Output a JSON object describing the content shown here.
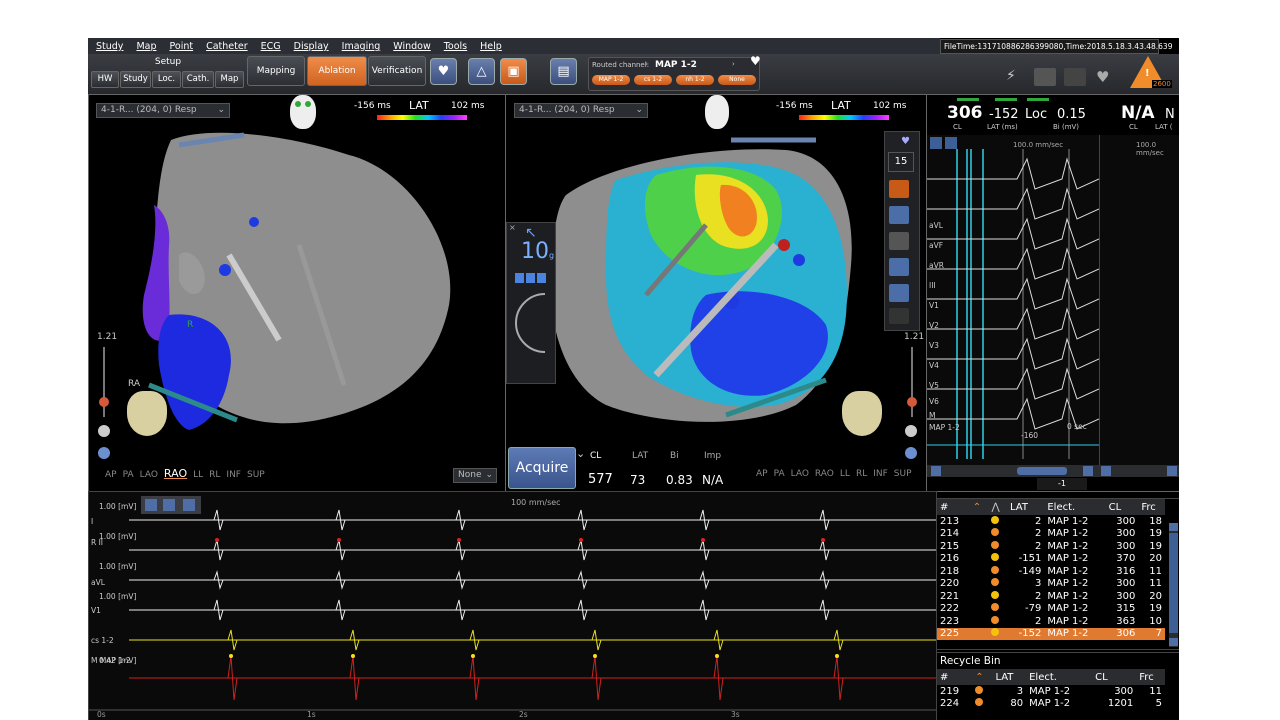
{
  "menu": [
    "Study",
    "Map",
    "Point",
    "Catheter",
    "ECG",
    "Display",
    "Imaging",
    "Window",
    "Tools",
    "Help"
  ],
  "file_time": "FileTime:131710886286399080,Time:2018.5.18.3.43.48.639",
  "toolbar": {
    "setup_label": "Setup",
    "setup_buttons": [
      "HW",
      "Study",
      "Loc.",
      "Cath.",
      "Map"
    ],
    "mode_buttons": [
      "Mapping",
      "Ablation",
      "Verification"
    ],
    "active_mode": "Ablation",
    "routed_label": "Routed channel:",
    "routed_value": "MAP 1-2",
    "routed_chips": [
      "MAP 1-2",
      "cs 1-2",
      "nh 1-2",
      "None"
    ],
    "badge": "2600"
  },
  "left_map": {
    "dropdown": "4-1-R... (204, 0) Resp",
    "lat_min": "-156 ms",
    "lat_title": "LAT",
    "lat_max": "102 ms",
    "scale_value": "1.21",
    "labels": [
      "R",
      "RA"
    ],
    "views": [
      "AP",
      "PA",
      "LAO",
      "RAO",
      "LL",
      "RL",
      "INF",
      "SUP"
    ],
    "selected_view": "RAO",
    "none_select": "None"
  },
  "right_map": {
    "dropdown": "4-1-R... (204, 0) Resp",
    "lat_min": "-156 ms",
    "lat_title": "LAT",
    "lat_max": "102 ms",
    "scale_value": "1.21",
    "views": [
      "AP",
      "PA",
      "LAO",
      "RAO",
      "LL",
      "RL",
      "INF",
      "SUP"
    ],
    "side_value": "15",
    "force_value": "10",
    "force_unit": "g",
    "acquire_label": "Acquire",
    "point_headers": [
      "CL",
      "LAT",
      "Bi",
      "Imp"
    ],
    "point_values": [
      "577",
      "73",
      "0.83",
      "N/A"
    ]
  },
  "signal_panel": {
    "cl_value": "306",
    "cl_label": "CL",
    "lat_value": "-152",
    "lat_label": "LAT (ms)",
    "loc_label": "Loc",
    "bi_value": "0.15",
    "bi_label": "Bi (mV)",
    "speed": "100.0 mm/sec",
    "leads": [
      "aVL",
      "aVF",
      "aVR",
      "III",
      "V1",
      "V2",
      "V3",
      "V4",
      "V5",
      "V6",
      "M",
      "MAP 1-2"
    ],
    "time_marker": "0 sec",
    "lat_marker": "-160",
    "nav_value": "-1",
    "speed_b": "100.0 mm/sec",
    "cl_b": "N/A",
    "cl_b_label": "CL",
    "lat_b_label": "LAT (",
    "lat_b_value": "N"
  },
  "ecg": {
    "speed": "100 mm/sec",
    "channels": [
      {
        "name": "I",
        "scale": "1.00 [mV]"
      },
      {
        "name": "R II",
        "scale": "1.00 [mV]"
      },
      {
        "name": "aVL",
        "scale": "1.00 [mV]"
      },
      {
        "name": "V1",
        "scale": "1.00 [mV]"
      },
      {
        "name": "cs 1-2",
        "scale": ""
      },
      {
        "name": "M MAP 1-2",
        "scale": "0.42 [mV]"
      }
    ],
    "time_labels": [
      "0s",
      "1s",
      "2s",
      "3s"
    ]
  },
  "points_table": {
    "headers": [
      "#",
      "",
      "",
      "LAT",
      "Elect.",
      "CL",
      "Frc"
    ],
    "rows": [
      {
        "n": "213",
        "lat": "2",
        "elect": "MAP 1-2",
        "cl": "300",
        "frc": "18"
      },
      {
        "n": "214",
        "lat": "2",
        "elect": "MAP 1-2",
        "cl": "300",
        "frc": "19"
      },
      {
        "n": "215",
        "lat": "2",
        "elect": "MAP 1-2",
        "cl": "300",
        "frc": "19"
      },
      {
        "n": "216",
        "lat": "-151",
        "elect": "MAP 1-2",
        "cl": "370",
        "frc": "20"
      },
      {
        "n": "218",
        "lat": "-149",
        "elect": "MAP 1-2",
        "cl": "316",
        "frc": "11"
      },
      {
        "n": "220",
        "lat": "3",
        "elect": "MAP 1-2",
        "cl": "300",
        "frc": "11"
      },
      {
        "n": "221",
        "lat": "2",
        "elect": "MAP 1-2",
        "cl": "300",
        "frc": "20"
      },
      {
        "n": "222",
        "lat": "-79",
        "elect": "MAP 1-2",
        "cl": "315",
        "frc": "19"
      },
      {
        "n": "223",
        "lat": "2",
        "elect": "MAP 1-2",
        "cl": "363",
        "frc": "10"
      },
      {
        "n": "225",
        "lat": "-152",
        "elect": "MAP 1-2",
        "cl": "306",
        "frc": "7"
      }
    ],
    "selected": "225"
  },
  "recycle_bin": {
    "title": "Recycle Bin",
    "headers": [
      "#",
      "",
      "LAT",
      "Elect.",
      "CL",
      "Frc"
    ],
    "rows": [
      {
        "n": "219",
        "lat": "3",
        "elect": "MAP 1-2",
        "cl": "300",
        "frc": "11"
      },
      {
        "n": "224",
        "lat": "80",
        "elect": "MAP 1-2",
        "cl": "1201",
        "frc": "5"
      }
    ]
  }
}
